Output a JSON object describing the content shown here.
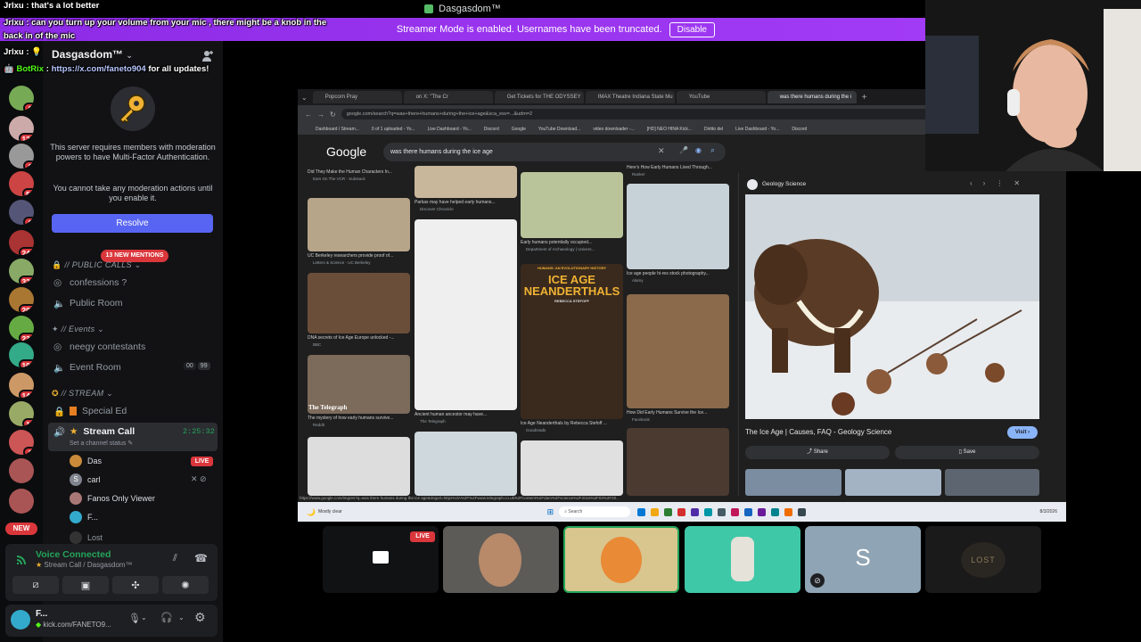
{
  "window": {
    "title": "Dasgasdom™"
  },
  "streamer_banner": {
    "text": "Streamer Mode is enabled. Usernames have been truncated.",
    "button": "Disable"
  },
  "chat_overlay": [
    {
      "user": "Jrlxu",
      "msg": ": that's a lot better"
    },
    {
      "user": "Jrlxu",
      "msg": ": can you turn up your volume from your mic , there might be a knob in the"
    },
    {
      "user": "",
      "msg": "back in of the mic"
    },
    {
      "user": "Jrlxu",
      "msg": ":"
    },
    {
      "user": "BotRix",
      "msg": ":",
      "link": "https://x.com/faneto904",
      "tail": "for all updates!"
    }
  ],
  "server_rail": {
    "badges": [
      "9",
      "126",
      "2",
      "56",
      "8",
      "241",
      "322",
      "208",
      "233",
      "103",
      "140",
      "13",
      "3"
    ],
    "new_label": "NEW"
  },
  "server": {
    "name": "Dasgasdom™",
    "mfa_text_1": "This server requires members with moderation powers to have Multi-Factor Authentication.",
    "mfa_text_2": "You cannot take any moderation actions until you enable it.",
    "resolve_label": "Resolve",
    "mentions_label": "13 NEW MENTIONS"
  },
  "channels": {
    "cat_public_calls": "// PUBLIC CALLS",
    "confessions": "confessions ?",
    "public_room": "Public Room",
    "cat_events": "// Events",
    "neegy": "neegy contestants",
    "event_room": "Event Room",
    "event_count_a": "00",
    "event_count_b": "99",
    "cat_stream": "// STREAM",
    "special_ed": "Special Ed",
    "stream_call": "Stream Call",
    "stream_time": "2:25:32",
    "set_status": "Set a channel status"
  },
  "voice_users": [
    {
      "name": "Das",
      "live": "LIVE"
    },
    {
      "name": "carl"
    },
    {
      "name": "Fanos Only Viewer"
    },
    {
      "name": "F..."
    },
    {
      "name": "Lost"
    }
  ],
  "voice_panel": {
    "status": "Voice Connected",
    "location": "Stream Call / Dasgasdom™"
  },
  "user_panel": {
    "name": "F...",
    "status": "kick.com/FANETO9..."
  },
  "browser": {
    "tabs": [
      "Popcorn Pray",
      "on X: \"The Cr",
      "Get Tickets for THE ODYSSEY",
      "IMAX Theatre Indiana State Mu",
      "YouTube",
      "was there humans during the i"
    ],
    "url": "google.com/search?q=was+there+humans+during+the+ice+age&sca_esv=...&udm=2",
    "bookmarks": [
      "Dashboard / Stream...",
      "0 of 1 uploaded - Yo...",
      "Live Dashboard - Yo...",
      "Discord",
      "Google",
      "YouTube Download...",
      "video downloader -...",
      "[HD] NEO HINA Kick...",
      "Diritto del",
      "Live Dashboard - Yo...",
      "Discord"
    ],
    "search_query": "was there humans during the ice age",
    "logo": "Google",
    "results": [
      {
        "cap": "Did They Make the Human Characters In...",
        "src": "Ears On The VCR - Substack"
      },
      {
        "cap": "UC Berkeley researchers provide proof of...",
        "src": "Letters & Science - UC Berkeley"
      },
      {
        "cap": "DNA secrets of Ice Age Europe unlocked -...",
        "src": "BBC"
      },
      {
        "cap": "The mystery of how early humans survive...",
        "src": "Reddit"
      },
      {
        "cap": "Parkas may have helped early humans...",
        "src": "Discover Chronicle"
      },
      {
        "cap": "Ancient human ancestor may have...",
        "src": "The Telegraph"
      },
      {
        "cap": "Early humans potentially occupied...",
        "src": "Department of Archaeology | Univers..."
      },
      {
        "cap": "Ice Age Neanderthals by Rebecca Stefoff ...",
        "src": "Goodreads"
      },
      {
        "cap": "Here's How Early Humans Lived Through...",
        "src": "Ranker"
      },
      {
        "cap": "Ice age people hi-res stock photography...",
        "src": "Alamy"
      },
      {
        "cap": "How Did Early Humans Survive the Ice...",
        "src": "Facebook"
      }
    ],
    "book_cover": {
      "top": "HUMANS: AN EVOLUTIONARY HISTORY",
      "title": "ICE AGE NEANDERTHALS",
      "author": "REBECCA STEFOFF"
    },
    "telegraph": "The Telegraph",
    "preview": {
      "source": "Geology Science",
      "title": "The Ice Age | Causes, FAQ - Geology Science",
      "visit": "Visit",
      "share": "Share",
      "save": "Save"
    },
    "status_url": "https://www.google.com/imgres?q=was there humans during the ice age&imgurl=https%3A%2F%2Fwww.telegraph.co.uk%2Fcontent%2Fdam%2Fscience%2F2016%2F03%2F20..."
  },
  "taskbar": {
    "weather": "Mostly clear",
    "search": "Search",
    "time": "",
    "date": "8/3/2026"
  },
  "participants": {
    "live": "LIVE",
    "tile_s": "S",
    "tile_lost": "LOST"
  }
}
